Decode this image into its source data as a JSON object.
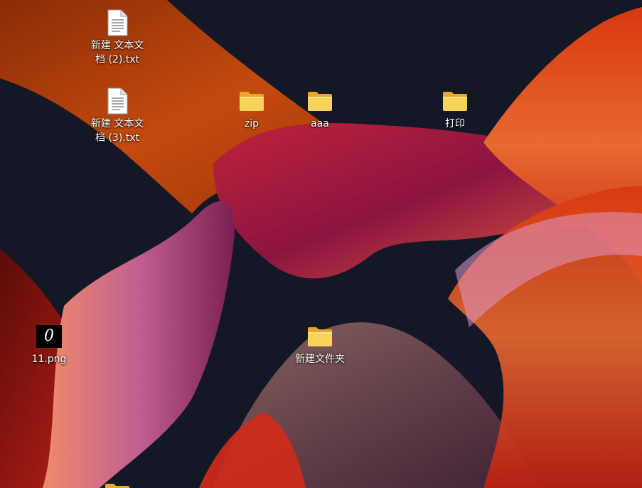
{
  "desktop": {
    "icons": [
      {
        "label": "新建 文本文\n档 (2).txt",
        "type": "text-file"
      },
      {
        "label": "新建 文本文\n档 (3).txt",
        "type": "text-file"
      },
      {
        "label": "zip",
        "type": "folder"
      },
      {
        "label": "aaa",
        "type": "folder"
      },
      {
        "label": "打印",
        "type": "folder"
      },
      {
        "label": "11.png",
        "type": "image-file",
        "thumbnail_text": "0"
      },
      {
        "label": "新建文件夹",
        "type": "folder"
      },
      {
        "label": "",
        "type": "folder"
      }
    ]
  },
  "colors": {
    "background": "#141826",
    "folder_yellow": "#f6c84c",
    "wallpaper_orange": "#c8460f",
    "wallpaper_red": "#b3122a"
  }
}
